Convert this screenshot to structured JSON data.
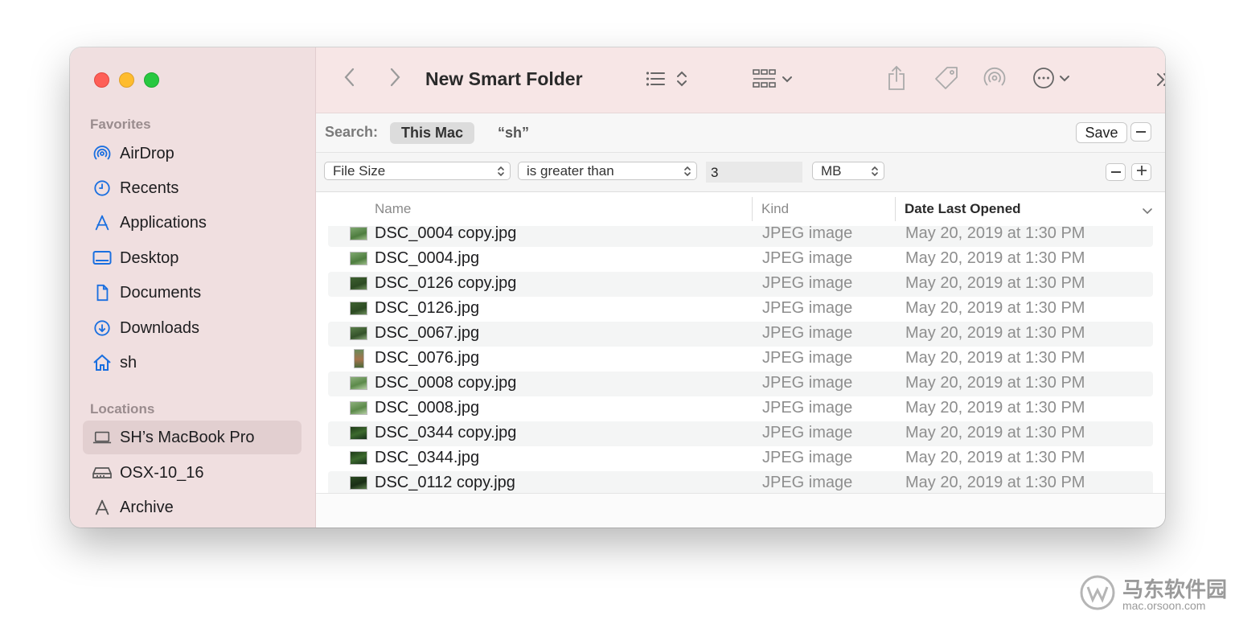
{
  "window": {
    "title": "New Smart Folder"
  },
  "sidebar": {
    "favorites_header": "Favorites",
    "favorites": [
      {
        "label": "AirDrop",
        "icon": "airdrop-icon"
      },
      {
        "label": "Recents",
        "icon": "clock-icon"
      },
      {
        "label": "Applications",
        "icon": "applications-icon"
      },
      {
        "label": "Desktop",
        "icon": "desktop-icon"
      },
      {
        "label": "Documents",
        "icon": "document-icon"
      },
      {
        "label": "Downloads",
        "icon": "download-icon"
      },
      {
        "label": "sh",
        "icon": "home-icon"
      }
    ],
    "locations_header": "Locations",
    "locations": [
      {
        "label": "SH’s MacBook Pro",
        "icon": "laptop-icon",
        "selected": true
      },
      {
        "label": "OSX-10_16",
        "icon": "disk-icon"
      },
      {
        "label": "Archive",
        "icon": "network-icon"
      }
    ]
  },
  "search": {
    "label": "Search:",
    "scope_selected": "This Mac",
    "scope_other": "“sh”",
    "save_label": "Save"
  },
  "criteria": {
    "attribute": "File Size",
    "operator": "is greater than",
    "value": "3",
    "unit": "MB"
  },
  "table": {
    "columns": [
      "Name",
      "Kind",
      "Date Last Opened"
    ],
    "sorted_column": "Date Last Opened",
    "rows": [
      {
        "name": "DSC_0004 copy.jpg",
        "kind": "JPEG image",
        "date": "May 20, 2019 at 1:30 PM"
      },
      {
        "name": "DSC_0004.jpg",
        "kind": "JPEG image",
        "date": "May 20, 2019 at 1:30 PM"
      },
      {
        "name": "DSC_0126 copy.jpg",
        "kind": "JPEG image",
        "date": "May 20, 2019 at 1:30 PM"
      },
      {
        "name": "DSC_0126.jpg",
        "kind": "JPEG image",
        "date": "May 20, 2019 at 1:30 PM"
      },
      {
        "name": "DSC_0067.jpg",
        "kind": "JPEG image",
        "date": "May 20, 2019 at 1:30 PM"
      },
      {
        "name": "DSC_0076.jpg",
        "kind": "JPEG image",
        "date": "May 20, 2019 at 1:30 PM"
      },
      {
        "name": "DSC_0008 copy.jpg",
        "kind": "JPEG image",
        "date": "May 20, 2019 at 1:30 PM"
      },
      {
        "name": "DSC_0008.jpg",
        "kind": "JPEG image",
        "date": "May 20, 2019 at 1:30 PM"
      },
      {
        "name": "DSC_0344 copy.jpg",
        "kind": "JPEG image",
        "date": "May 20, 2019 at 1:30 PM"
      },
      {
        "name": "DSC_0344.jpg",
        "kind": "JPEG image",
        "date": "May 20, 2019 at 1:30 PM"
      },
      {
        "name": "DSC_0112 copy.jpg",
        "kind": "JPEG image",
        "date": "May 20, 2019 at 1:30 PM"
      }
    ]
  },
  "watermark": {
    "text": "马东软件园",
    "sub": "mac.orsoon.com"
  },
  "colors": {
    "sidebar_bg": "#f0dfe0",
    "toolbar_bg": "#f7e6e6",
    "accent": "#1a6fe0",
    "close": "#fe5f57",
    "minimize": "#febc2e",
    "zoom": "#28c840"
  }
}
